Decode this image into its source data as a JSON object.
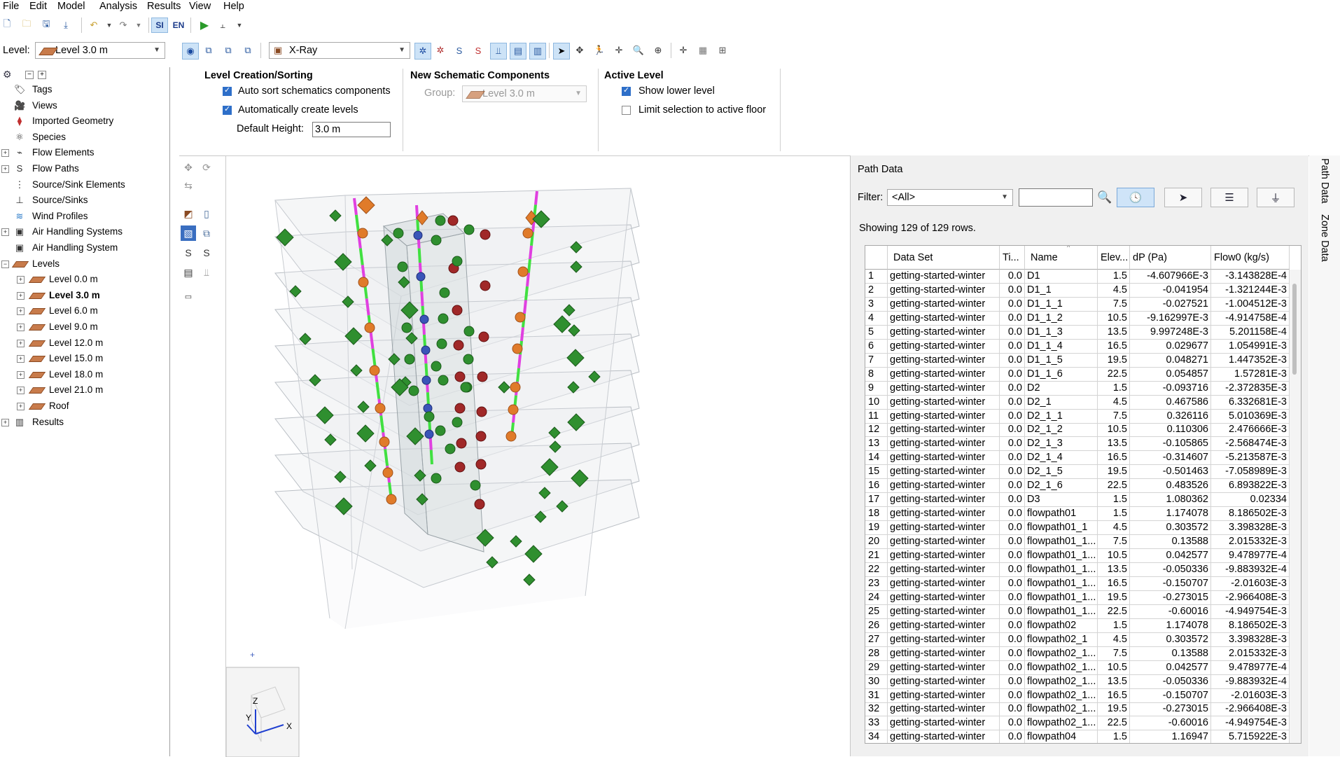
{
  "menu": [
    "File",
    "Edit",
    "Model",
    "Analysis",
    "Results",
    "View",
    "Help"
  ],
  "toolbar": {
    "si_label": "SI",
    "en_label": "EN"
  },
  "level_bar": {
    "label": "Level:",
    "selected": "Level 3.0 m"
  },
  "view_bar": {
    "view_mode": "X-Ray"
  },
  "tree": [
    {
      "label": "Tags",
      "icon": "tag-icon",
      "expander": false,
      "indent": 0,
      "bold": false
    },
    {
      "label": "Views",
      "icon": "camera-icon",
      "expander": false,
      "indent": 0,
      "bold": false
    },
    {
      "label": "Imported Geometry",
      "icon": "geometry-icon",
      "expander": false,
      "indent": 0,
      "bold": false
    },
    {
      "label": "Species",
      "icon": "species-icon",
      "expander": false,
      "indent": 0,
      "bold": false
    },
    {
      "label": "Flow Elements",
      "icon": "flow-element-icon",
      "expander": true,
      "indent": 0,
      "bold": false
    },
    {
      "label": "Flow Paths",
      "icon": "flow-path-icon",
      "expander": true,
      "indent": 0,
      "bold": false
    },
    {
      "label": "Source/Sink Elements",
      "icon": "source-sink-element-icon",
      "expander": false,
      "indent": 0,
      "bold": false
    },
    {
      "label": "Source/Sinks",
      "icon": "source-sink-icon",
      "expander": false,
      "indent": 0,
      "bold": false
    },
    {
      "label": "Wind Profiles",
      "icon": "wind-icon",
      "expander": false,
      "indent": 0,
      "bold": false
    },
    {
      "label": "Air Handling Systems",
      "icon": "ahs-icon",
      "expander": true,
      "indent": 0,
      "bold": false
    },
    {
      "label": "Air Handling System",
      "icon": "ahs-icon",
      "expander": false,
      "indent": 0,
      "bold": false
    },
    {
      "label": "Levels",
      "icon": "level-icon",
      "expander": true,
      "expanded": true,
      "indent": 0,
      "bold": false
    },
    {
      "label": "Level 0.0 m",
      "icon": "level-icon",
      "expander": true,
      "indent": 1,
      "bold": false
    },
    {
      "label": "Level 3.0 m",
      "icon": "level-icon",
      "expander": true,
      "indent": 1,
      "bold": true
    },
    {
      "label": "Level 6.0 m",
      "icon": "level-icon",
      "expander": true,
      "indent": 1,
      "bold": false
    },
    {
      "label": "Level 9.0 m",
      "icon": "level-icon",
      "expander": true,
      "indent": 1,
      "bold": false
    },
    {
      "label": "Level 12.0 m",
      "icon": "level-icon",
      "expander": true,
      "indent": 1,
      "bold": false
    },
    {
      "label": "Level 15.0 m",
      "icon": "level-icon",
      "expander": true,
      "indent": 1,
      "bold": false
    },
    {
      "label": "Level 18.0 m",
      "icon": "level-icon",
      "expander": true,
      "indent": 1,
      "bold": false
    },
    {
      "label": "Level 21.0 m",
      "icon": "level-icon",
      "expander": true,
      "indent": 1,
      "bold": false
    },
    {
      "label": "Roof",
      "icon": "level-icon",
      "expander": true,
      "indent": 1,
      "bold": false
    },
    {
      "label": "Results",
      "icon": "chart-icon",
      "expander": true,
      "indent": 0,
      "bold": false
    }
  ],
  "ribbon": {
    "level_creation": {
      "title": "Level Creation/Sorting",
      "auto_sort": {
        "label": "Auto sort schematics components",
        "checked": true
      },
      "auto_create": {
        "label": "Automatically create levels",
        "checked": true
      },
      "default_height_label": "Default Height:",
      "default_height_value": "3.0 m"
    },
    "new_schematic": {
      "title": "New Schematic Components",
      "group_label": "Group:",
      "group_value": "Level 3.0 m"
    },
    "active_level": {
      "title": "Active Level",
      "show_lower": {
        "label": "Show lower level",
        "checked": true
      },
      "limit_selection": {
        "label": "Limit selection to active floor",
        "checked": false
      }
    }
  },
  "path_data": {
    "title": "Path Data",
    "filter_label": "Filter:",
    "filter_value": "<All>",
    "search_value": "",
    "row_count_text": "Showing 129 of 129 rows.",
    "columns": [
      "Data Set",
      "Ti...",
      "Name",
      "Elev...",
      "dP (Pa)",
      "Flow0 (kg/s)"
    ],
    "rows": [
      [
        "1",
        "getting-started-winter",
        "0.0",
        "D1",
        "1.5",
        "-4.607966E-3",
        "-3.143828E-4"
      ],
      [
        "2",
        "getting-started-winter",
        "0.0",
        "D1_1",
        "4.5",
        "-0.041954",
        "-1.321244E-3"
      ],
      [
        "3",
        "getting-started-winter",
        "0.0",
        "D1_1_1",
        "7.5",
        "-0.027521",
        "-1.004512E-3"
      ],
      [
        "4",
        "getting-started-winter",
        "0.0",
        "D1_1_2",
        "10.5",
        "-9.162997E-3",
        "-4.914758E-4"
      ],
      [
        "5",
        "getting-started-winter",
        "0.0",
        "D1_1_3",
        "13.5",
        "9.997248E-3",
        "5.201158E-4"
      ],
      [
        "6",
        "getting-started-winter",
        "0.0",
        "D1_1_4",
        "16.5",
        "0.029677",
        "1.054991E-3"
      ],
      [
        "7",
        "getting-started-winter",
        "0.0",
        "D1_1_5",
        "19.5",
        "0.048271",
        "1.447352E-3"
      ],
      [
        "8",
        "getting-started-winter",
        "0.0",
        "D1_1_6",
        "22.5",
        "0.054857",
        "1.57281E-3"
      ],
      [
        "9",
        "getting-started-winter",
        "0.0",
        "D2",
        "1.5",
        "-0.093716",
        "-2.372835E-3"
      ],
      [
        "10",
        "getting-started-winter",
        "0.0",
        "D2_1",
        "4.5",
        "0.467586",
        "6.332681E-3"
      ],
      [
        "11",
        "getting-started-winter",
        "0.0",
        "D2_1_1",
        "7.5",
        "0.326116",
        "5.010369E-3"
      ],
      [
        "12",
        "getting-started-winter",
        "0.0",
        "D2_1_2",
        "10.5",
        "0.110306",
        "2.476666E-3"
      ],
      [
        "13",
        "getting-started-winter",
        "0.0",
        "D2_1_3",
        "13.5",
        "-0.105865",
        "-2.568474E-3"
      ],
      [
        "14",
        "getting-started-winter",
        "0.0",
        "D2_1_4",
        "16.5",
        "-0.314607",
        "-5.213587E-3"
      ],
      [
        "15",
        "getting-started-winter",
        "0.0",
        "D2_1_5",
        "19.5",
        "-0.501463",
        "-7.058989E-3"
      ],
      [
        "16",
        "getting-started-winter",
        "0.0",
        "D2_1_6",
        "22.5",
        "0.483526",
        "6.893822E-3"
      ],
      [
        "17",
        "getting-started-winter",
        "0.0",
        "D3",
        "1.5",
        "1.080362",
        "0.02334"
      ],
      [
        "18",
        "getting-started-winter",
        "0.0",
        "flowpath01",
        "1.5",
        "1.174078",
        "8.186502E-3"
      ],
      [
        "19",
        "getting-started-winter",
        "0.0",
        "flowpath01_1",
        "4.5",
        "0.303572",
        "3.398328E-3"
      ],
      [
        "20",
        "getting-started-winter",
        "0.0",
        "flowpath01_1...",
        "7.5",
        "0.13588",
        "2.015332E-3"
      ],
      [
        "21",
        "getting-started-winter",
        "0.0",
        "flowpath01_1...",
        "10.5",
        "0.042577",
        "9.478977E-4"
      ],
      [
        "22",
        "getting-started-winter",
        "0.0",
        "flowpath01_1...",
        "13.5",
        "-0.050336",
        "-9.883932E-4"
      ],
      [
        "23",
        "getting-started-winter",
        "0.0",
        "flowpath01_1...",
        "16.5",
        "-0.150707",
        "-2.01603E-3"
      ],
      [
        "24",
        "getting-started-winter",
        "0.0",
        "flowpath01_1...",
        "19.5",
        "-0.273015",
        "-2.966408E-3"
      ],
      [
        "25",
        "getting-started-winter",
        "0.0",
        "flowpath01_1...",
        "22.5",
        "-0.60016",
        "-4.949754E-3"
      ],
      [
        "26",
        "getting-started-winter",
        "0.0",
        "flowpath02",
        "1.5",
        "1.174078",
        "8.186502E-3"
      ],
      [
        "27",
        "getting-started-winter",
        "0.0",
        "flowpath02_1",
        "4.5",
        "0.303572",
        "3.398328E-3"
      ],
      [
        "28",
        "getting-started-winter",
        "0.0",
        "flowpath02_1...",
        "7.5",
        "0.13588",
        "2.015332E-3"
      ],
      [
        "29",
        "getting-started-winter",
        "0.0",
        "flowpath02_1...",
        "10.5",
        "0.042577",
        "9.478977E-4"
      ],
      [
        "30",
        "getting-started-winter",
        "0.0",
        "flowpath02_1...",
        "13.5",
        "-0.050336",
        "-9.883932E-4"
      ],
      [
        "31",
        "getting-started-winter",
        "0.0",
        "flowpath02_1...",
        "16.5",
        "-0.150707",
        "-2.01603E-3"
      ],
      [
        "32",
        "getting-started-winter",
        "0.0",
        "flowpath02_1...",
        "19.5",
        "-0.273015",
        "-2.966408E-3"
      ],
      [
        "33",
        "getting-started-winter",
        "0.0",
        "flowpath02_1...",
        "22.5",
        "-0.60016",
        "-4.949754E-3"
      ],
      [
        "34",
        "getting-started-winter",
        "0.0",
        "flowpath04",
        "1.5",
        "1.16947",
        "5.715922E-3"
      ]
    ]
  },
  "side_tabs": [
    "Path Data",
    "Zone Data"
  ],
  "axes": {
    "x": "X",
    "y": "Y",
    "z": "Z"
  },
  "colors": {
    "accent": "#2e6fc9",
    "zone_node": "#2f8f2f",
    "airflow_node": "#e07b2a",
    "duct_magenta": "#e040e0",
    "duct_green": "#40e040",
    "junction_blue": "#3a55b8",
    "terminal_red": "#a02828"
  }
}
